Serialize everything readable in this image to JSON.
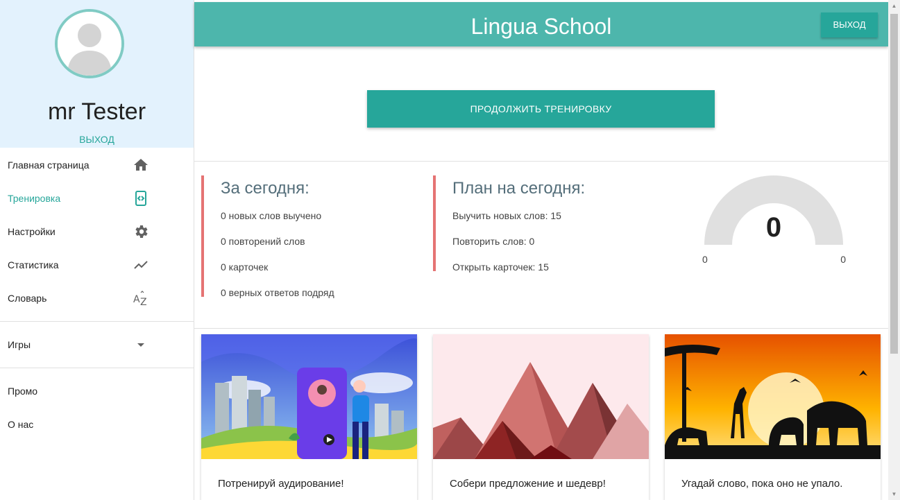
{
  "profile": {
    "name": "mr Tester",
    "logout_label": "ВЫХОД"
  },
  "nav": {
    "items": [
      {
        "label": "Главная страница",
        "icon": "home-icon"
      },
      {
        "label": "Тренировка",
        "icon": "training-icon",
        "active": true
      },
      {
        "label": "Настройки",
        "icon": "gear-icon"
      },
      {
        "label": "Статистика",
        "icon": "trending-up-icon"
      },
      {
        "label": "Словарь",
        "icon": "sort-az-icon"
      }
    ],
    "games_label": "Игры",
    "promo_label": "Промо",
    "about_label": "О нас"
  },
  "header": {
    "title": "Lingua School",
    "logout_label": "ВЫХОД"
  },
  "main": {
    "continue_label": "ПРОДОЛЖИТЬ ТРЕНИРОВКУ",
    "today": {
      "title": "За сегодня:",
      "lines": [
        "0 новых слов выучено",
        "0 повторений слов",
        "0 карточек",
        "0 верных ответов подряд"
      ]
    },
    "plan": {
      "title": "План на сегодня:",
      "lines": [
        "Выучить новых слов: 15",
        "Повторить слов: 0",
        "Открыть карточек: 15"
      ]
    },
    "gauge": {
      "value": "0",
      "min": "0",
      "max": "0"
    }
  },
  "cards": [
    {
      "text": "Потренируй аудирование!",
      "illustration": "listening-illustration"
    },
    {
      "text": "Собери предложение и шедевр!",
      "illustration": "pyramids-illustration"
    },
    {
      "text": "Угадай слово, пока оно не упало.",
      "illustration": "savanna-illustration"
    }
  ],
  "colors": {
    "accent": "#26a69a",
    "header": "#4db6ac",
    "stat_border": "#e57373",
    "profile_bg": "#e3f2fd"
  }
}
